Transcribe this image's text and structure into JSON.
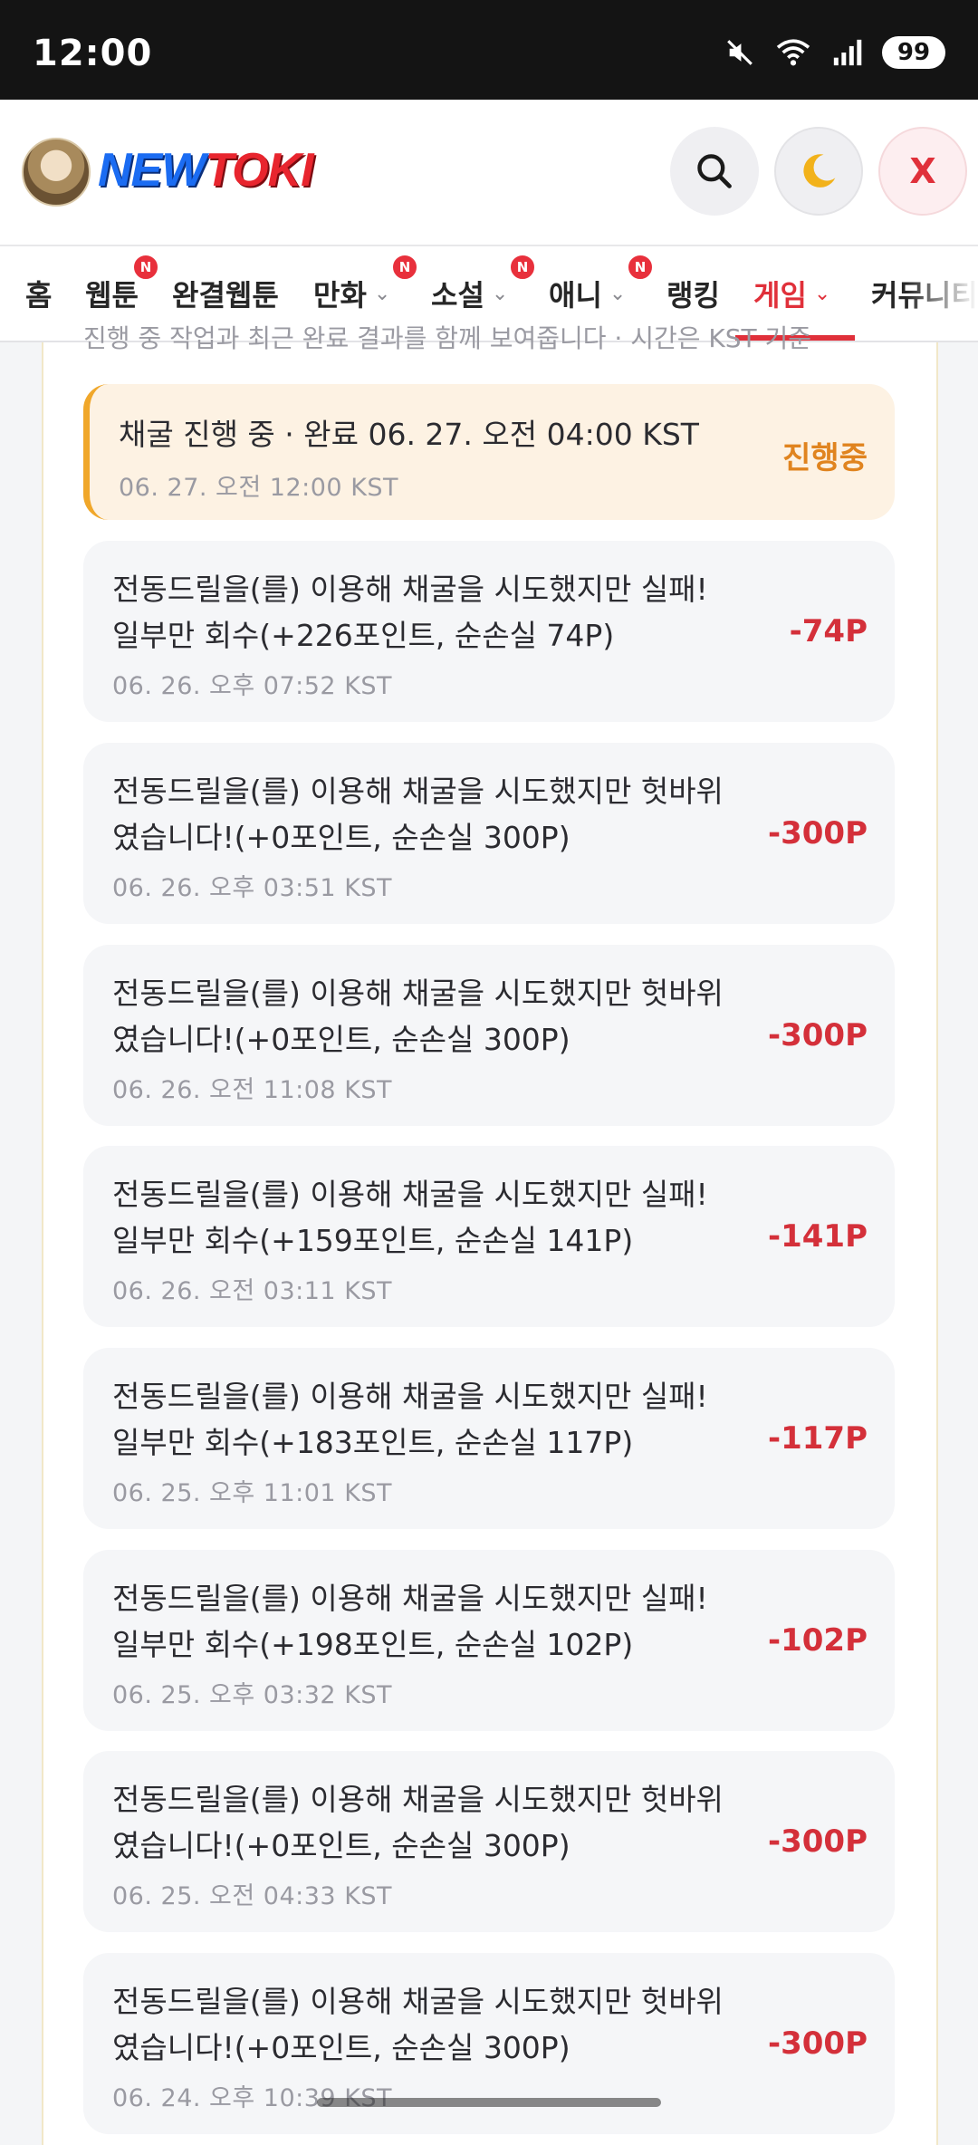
{
  "status_bar": {
    "time": "12:00",
    "battery": "99",
    "signal_sub": "5"
  },
  "header": {
    "logo_new": "NEW",
    "logo_toki": "TOKI",
    "close_label": "X"
  },
  "nav": {
    "items": [
      {
        "label": "홈",
        "badge": "",
        "dropdown": false,
        "active": false
      },
      {
        "label": "웹툰",
        "badge": "N",
        "dropdown": false,
        "active": false
      },
      {
        "label": "완결웹툰",
        "badge": "",
        "dropdown": false,
        "active": false
      },
      {
        "label": "만화",
        "badge": "N",
        "dropdown": true,
        "active": false
      },
      {
        "label": "소설",
        "badge": "N",
        "dropdown": true,
        "active": false
      },
      {
        "label": "애니",
        "badge": "N",
        "dropdown": true,
        "active": false
      },
      {
        "label": "랭킹",
        "badge": "",
        "dropdown": false,
        "active": false
      },
      {
        "label": "게임",
        "badge": "",
        "dropdown": true,
        "active": true
      },
      {
        "label": "커뮤니티",
        "badge": "",
        "dropdown": false,
        "active": false
      }
    ],
    "active_color": "#e0303a"
  },
  "cut_text": "진행 중 작업과 최근 완료 결과를 함께 보여줍니다 · 시간은 KST 기준",
  "records": [
    {
      "message": "채굴 진행 중 · 완료 06. 27. 오전 04:00 KST",
      "date": "06. 27. 오전 12:00 KST",
      "amount": "진행중",
      "status": "active"
    },
    {
      "message": "전동드릴을(를) 이용해 채굴을 시도했지만 실패! 일부만 회수(+226포인트, 순손실 74P)",
      "date": "06. 26. 오후 07:52 KST",
      "amount": "-74P",
      "status": "loss"
    },
    {
      "message": "전동드릴을(를) 이용해 채굴을 시도했지만 헛바위였습니다!(+0포인트, 순손실 300P)",
      "date": "06. 26. 오후 03:51 KST",
      "amount": "-300P",
      "status": "loss"
    },
    {
      "message": "전동드릴을(를) 이용해 채굴을 시도했지만 헛바위였습니다!(+0포인트, 순손실 300P)",
      "date": "06. 26. 오전 11:08 KST",
      "amount": "-300P",
      "status": "loss"
    },
    {
      "message": "전동드릴을(를) 이용해 채굴을 시도했지만 실패! 일부만 회수(+159포인트, 순손실 141P)",
      "date": "06. 26. 오전 03:11 KST",
      "amount": "-141P",
      "status": "loss"
    },
    {
      "message": "전동드릴을(를) 이용해 채굴을 시도했지만 실패! 일부만 회수(+183포인트, 순손실 117P)",
      "date": "06. 25. 오후 11:01 KST",
      "amount": "-117P",
      "status": "loss"
    },
    {
      "message": "전동드릴을(를) 이용해 채굴을 시도했지만 실패! 일부만 회수(+198포인트, 순손실 102P)",
      "date": "06. 25. 오후 03:32 KST",
      "amount": "-102P",
      "status": "loss"
    },
    {
      "message": "전동드릴을(를) 이용해 채굴을 시도했지만 헛바위였습니다!(+0포인트, 순손실 300P)",
      "date": "06. 25. 오전 04:33 KST",
      "amount": "-300P",
      "status": "loss"
    },
    {
      "message": "전동드릴을(를) 이용해 채굴을 시도했지만 헛바위였습니다!(+0포인트, 순손실 300P)",
      "date": "06. 24. 오후 10:39 KST",
      "amount": "-300P",
      "status": "loss"
    }
  ],
  "colors": {
    "loss": "#d4303a",
    "active": "#e0841f",
    "active_bg": "#fdf2e3",
    "active_border": "#f0a72a"
  }
}
